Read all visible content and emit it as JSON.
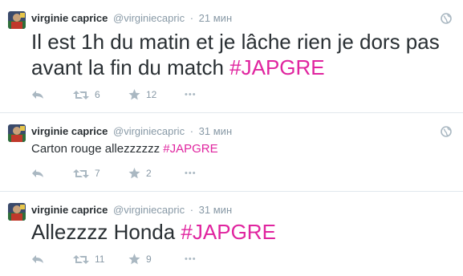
{
  "colors": {
    "hashtag": "#e0249f",
    "muted": "#8899a6",
    "icon": "#aab8c2",
    "divider": "#e1e8ed"
  },
  "tweets": [
    {
      "name": "virginie caprice",
      "handle": "@virginiecapric",
      "sep": "·",
      "time": "21 мин",
      "text": "Il est 1h du matin et je lâche rien je dors pas avant la fin du match ",
      "hashtag": "#JAPGRE",
      "retweets": "6",
      "favorites": "12",
      "more": "•••",
      "icons": [
        "globe-icon",
        "reply-icon",
        "retweet-icon",
        "star-icon",
        "more-icon"
      ]
    },
    {
      "name": "virginie caprice",
      "handle": "@virginiecapric",
      "sep": "·",
      "time": "31 мин",
      "text": "Carton rouge allezzzzzz ",
      "hashtag": "#JAPGRE",
      "retweets": "7",
      "favorites": "2",
      "more": "•••",
      "icons": [
        "globe-icon",
        "reply-icon",
        "retweet-icon",
        "star-icon",
        "more-icon"
      ]
    },
    {
      "name": "virginie caprice",
      "handle": "@virginiecapric",
      "sep": "·",
      "time": "31 мин",
      "text": "Allezzzz Honda ",
      "hashtag": "#JAPGRE",
      "retweets": "11",
      "favorites": "9",
      "more": "•••",
      "icons": [
        "reply-icon",
        "retweet-icon",
        "star-icon",
        "more-icon"
      ]
    }
  ]
}
